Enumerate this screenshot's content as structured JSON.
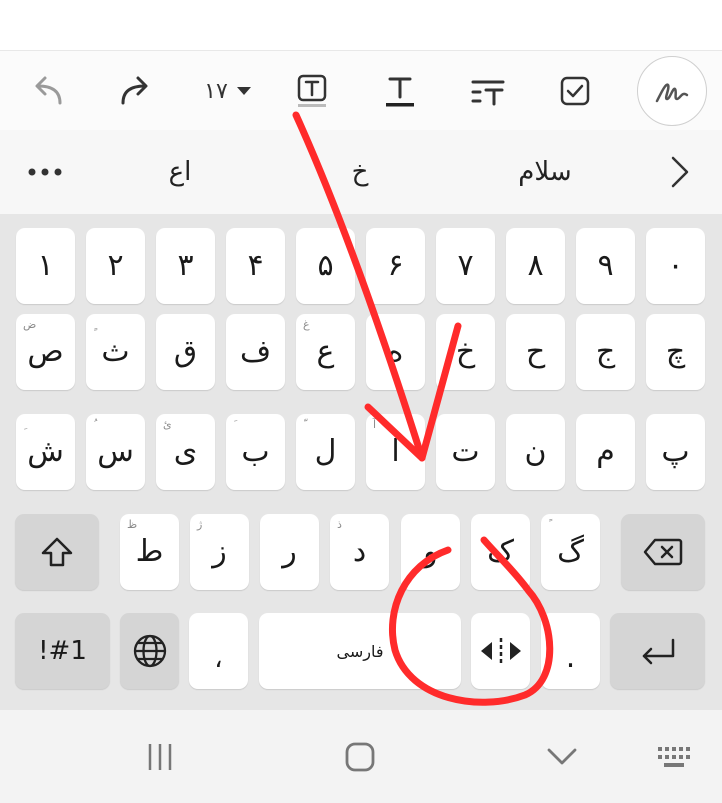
{
  "toolbar": {
    "font_size": "۱۷"
  },
  "suggestions": [
    "اع",
    "خ",
    "سلام"
  ],
  "rows": [
    [
      {
        "ch": "۱"
      },
      {
        "ch": "۲"
      },
      {
        "ch": "۳"
      },
      {
        "ch": "۴"
      },
      {
        "ch": "۵"
      },
      {
        "ch": "۶"
      },
      {
        "ch": "۷"
      },
      {
        "ch": "۸"
      },
      {
        "ch": "۹"
      },
      {
        "ch": "۰"
      }
    ],
    [
      {
        "ch": "ص",
        "hint": "ض"
      },
      {
        "ch": "ث",
        "hint": "ٍ"
      },
      {
        "ch": "ق"
      },
      {
        "ch": "ف"
      },
      {
        "ch": "ع",
        "hint": "غ"
      },
      {
        "ch": "ه"
      },
      {
        "ch": "خ"
      },
      {
        "ch": "ح"
      },
      {
        "ch": "ج"
      },
      {
        "ch": "چ"
      }
    ],
    [
      {
        "ch": "ش",
        "hint": "ِ"
      },
      {
        "ch": "س",
        "hint": "ُ"
      },
      {
        "ch": "ی",
        "hint": "ئ"
      },
      {
        "ch": "ب",
        "hint": "َ"
      },
      {
        "ch": "ل",
        "hint": "ّ"
      },
      {
        "ch": "ا",
        "hint": "آ"
      },
      {
        "ch": "ت"
      },
      {
        "ch": "ن"
      },
      {
        "ch": "م"
      },
      {
        "ch": "پ"
      }
    ],
    [
      {
        "ch": "ط",
        "hint": "ظ"
      },
      {
        "ch": "ز",
        "hint": "ژ"
      },
      {
        "ch": "ر"
      },
      {
        "ch": "د",
        "hint": "ذ"
      },
      {
        "ch": "و"
      },
      {
        "ch": "ک"
      },
      {
        "ch": "گ",
        "hint": "ً"
      }
    ]
  ],
  "bottom": {
    "symbols_label": "!#1",
    "comma": "،",
    "space_label": "فارسی",
    "period": "."
  },
  "annotation_color": "#ff2b2b"
}
